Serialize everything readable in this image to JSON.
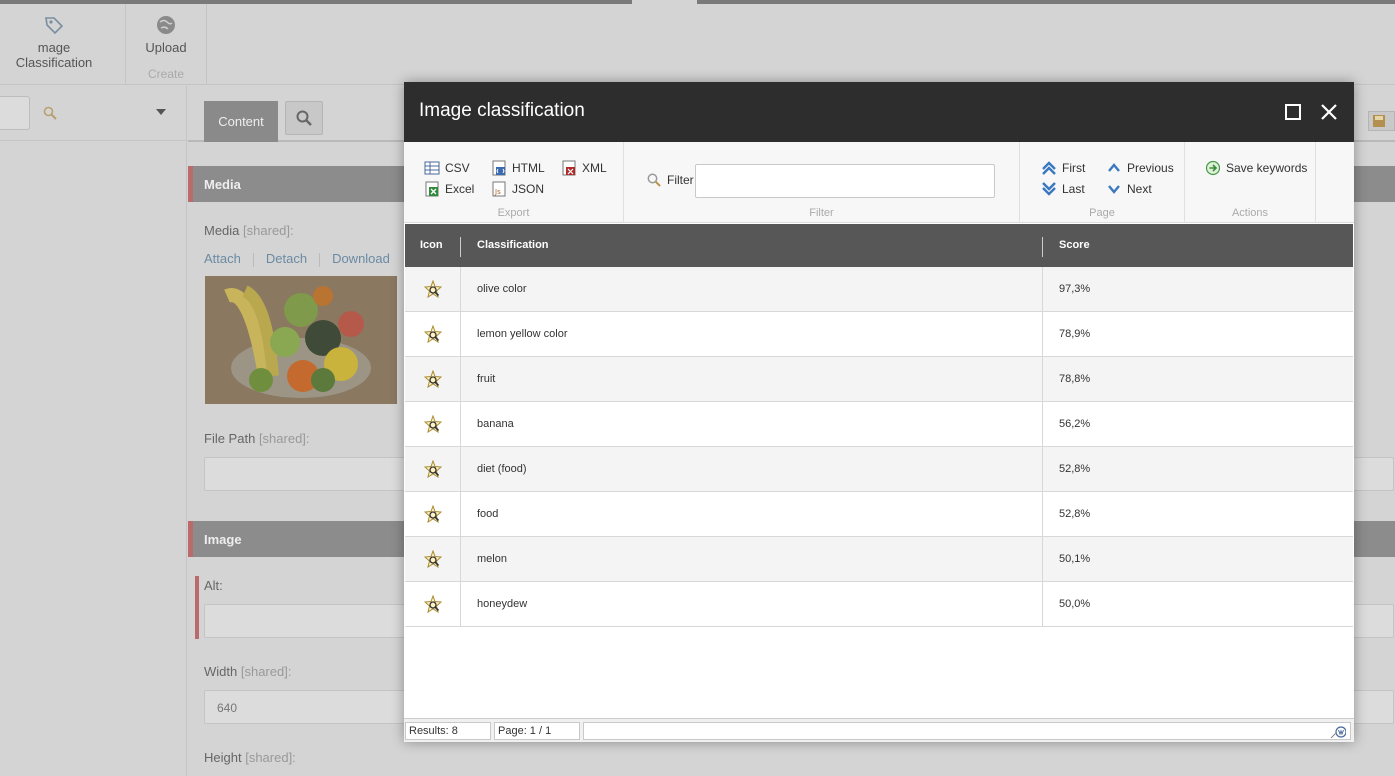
{
  "ribbon": {
    "image_classification_label": "mage Classification",
    "upload_label": "Upload",
    "create_group_label": "Create"
  },
  "editor": {
    "tab_content_label": "Content",
    "sections": {
      "media_title": "Media",
      "image_title": "Image"
    },
    "fields": {
      "media_label": "Media",
      "file_path_label": "File Path",
      "alt_label": "Alt:",
      "width_label": "Width",
      "width_value": "640",
      "height_label": "Height",
      "shared_tag": "[shared]:"
    },
    "media_actions": {
      "attach": "Attach",
      "detach": "Detach",
      "download": "Download"
    }
  },
  "dialog": {
    "title": "Image classification",
    "ribbon": {
      "export": {
        "csv": "CSV",
        "excel": "Excel",
        "html": "HTML",
        "json": "JSON",
        "xml": "XML",
        "group": "Export"
      },
      "filter": {
        "label": "Filter",
        "value": "",
        "group": "Filter"
      },
      "page": {
        "first": "First",
        "last": "Last",
        "previous": "Previous",
        "next": "Next",
        "group": "Page"
      },
      "actions": {
        "save_keywords": "Save keywords",
        "group": "Actions"
      }
    },
    "grid": {
      "headers": {
        "icon": "Icon",
        "classification": "Classification",
        "score": "Score"
      },
      "rows": [
        {
          "classification": "olive color",
          "score": "97,3%"
        },
        {
          "classification": "lemon yellow color",
          "score": "78,9%"
        },
        {
          "classification": "fruit",
          "score": "78,8%"
        },
        {
          "classification": "banana",
          "score": "56,2%"
        },
        {
          "classification": "diet (food)",
          "score": "52,8%"
        },
        {
          "classification": "food",
          "score": "52,8%"
        },
        {
          "classification": "melon",
          "score": "50,1%"
        },
        {
          "classification": "honeydew",
          "score": "50,0%"
        }
      ]
    },
    "status": {
      "results": "Results: 8",
      "page": "Page: 1 / 1"
    }
  },
  "colors": {
    "dialog_title_bg": "#2d2d2d",
    "grid_header_bg": "#575757",
    "section_accent": "#b96a6a"
  }
}
